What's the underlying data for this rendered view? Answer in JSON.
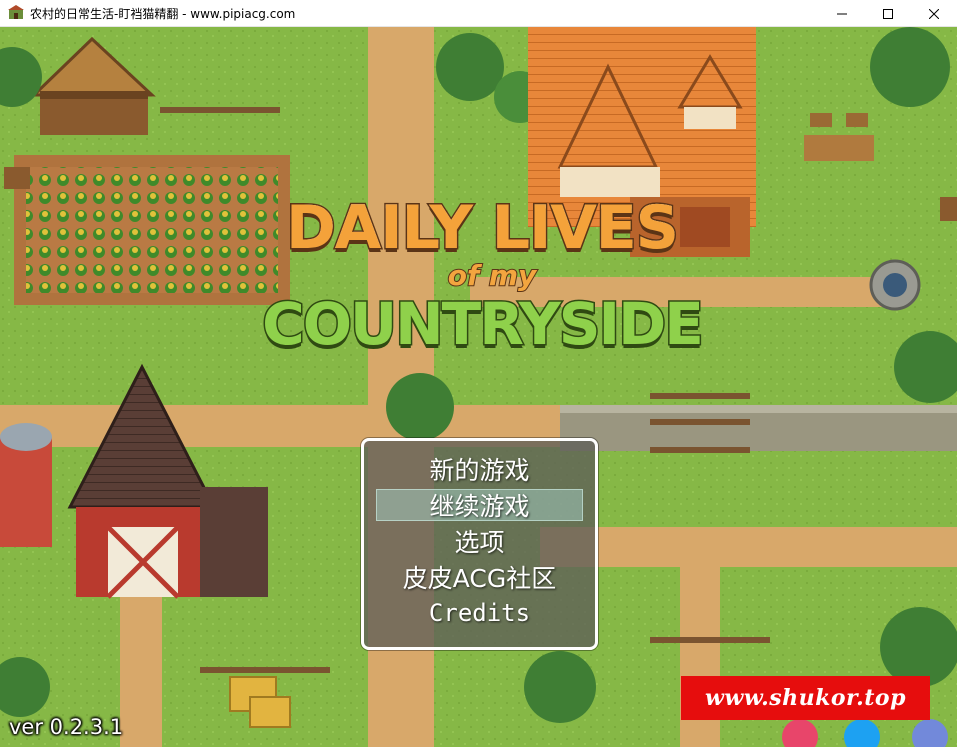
{
  "window": {
    "title": "农村的日常生活-盯裆猫精翻 - www.pipiacg.com",
    "controls": [
      "minimize-icon",
      "maximize-icon",
      "close-icon"
    ]
  },
  "logo": {
    "line1": "DAILY LIVES",
    "line2": "of my",
    "line3": "COUNTRYSIDE"
  },
  "menu": {
    "items": [
      "新的游戏",
      "继续游戏",
      "选项",
      "皮皮ACG社区",
      "Credits"
    ],
    "selected_index": 1
  },
  "version": "ver 0.2.3.1",
  "watermark": "www.shukor.top",
  "colors": {
    "grass": "#86b846",
    "path": "#d8a86a",
    "menu_bg": "#5f5f58",
    "selection": "#a0c8be",
    "logo_orange": "#f4a23a",
    "logo_green": "#8fd14b",
    "watermark_red": "#e60d0d"
  }
}
